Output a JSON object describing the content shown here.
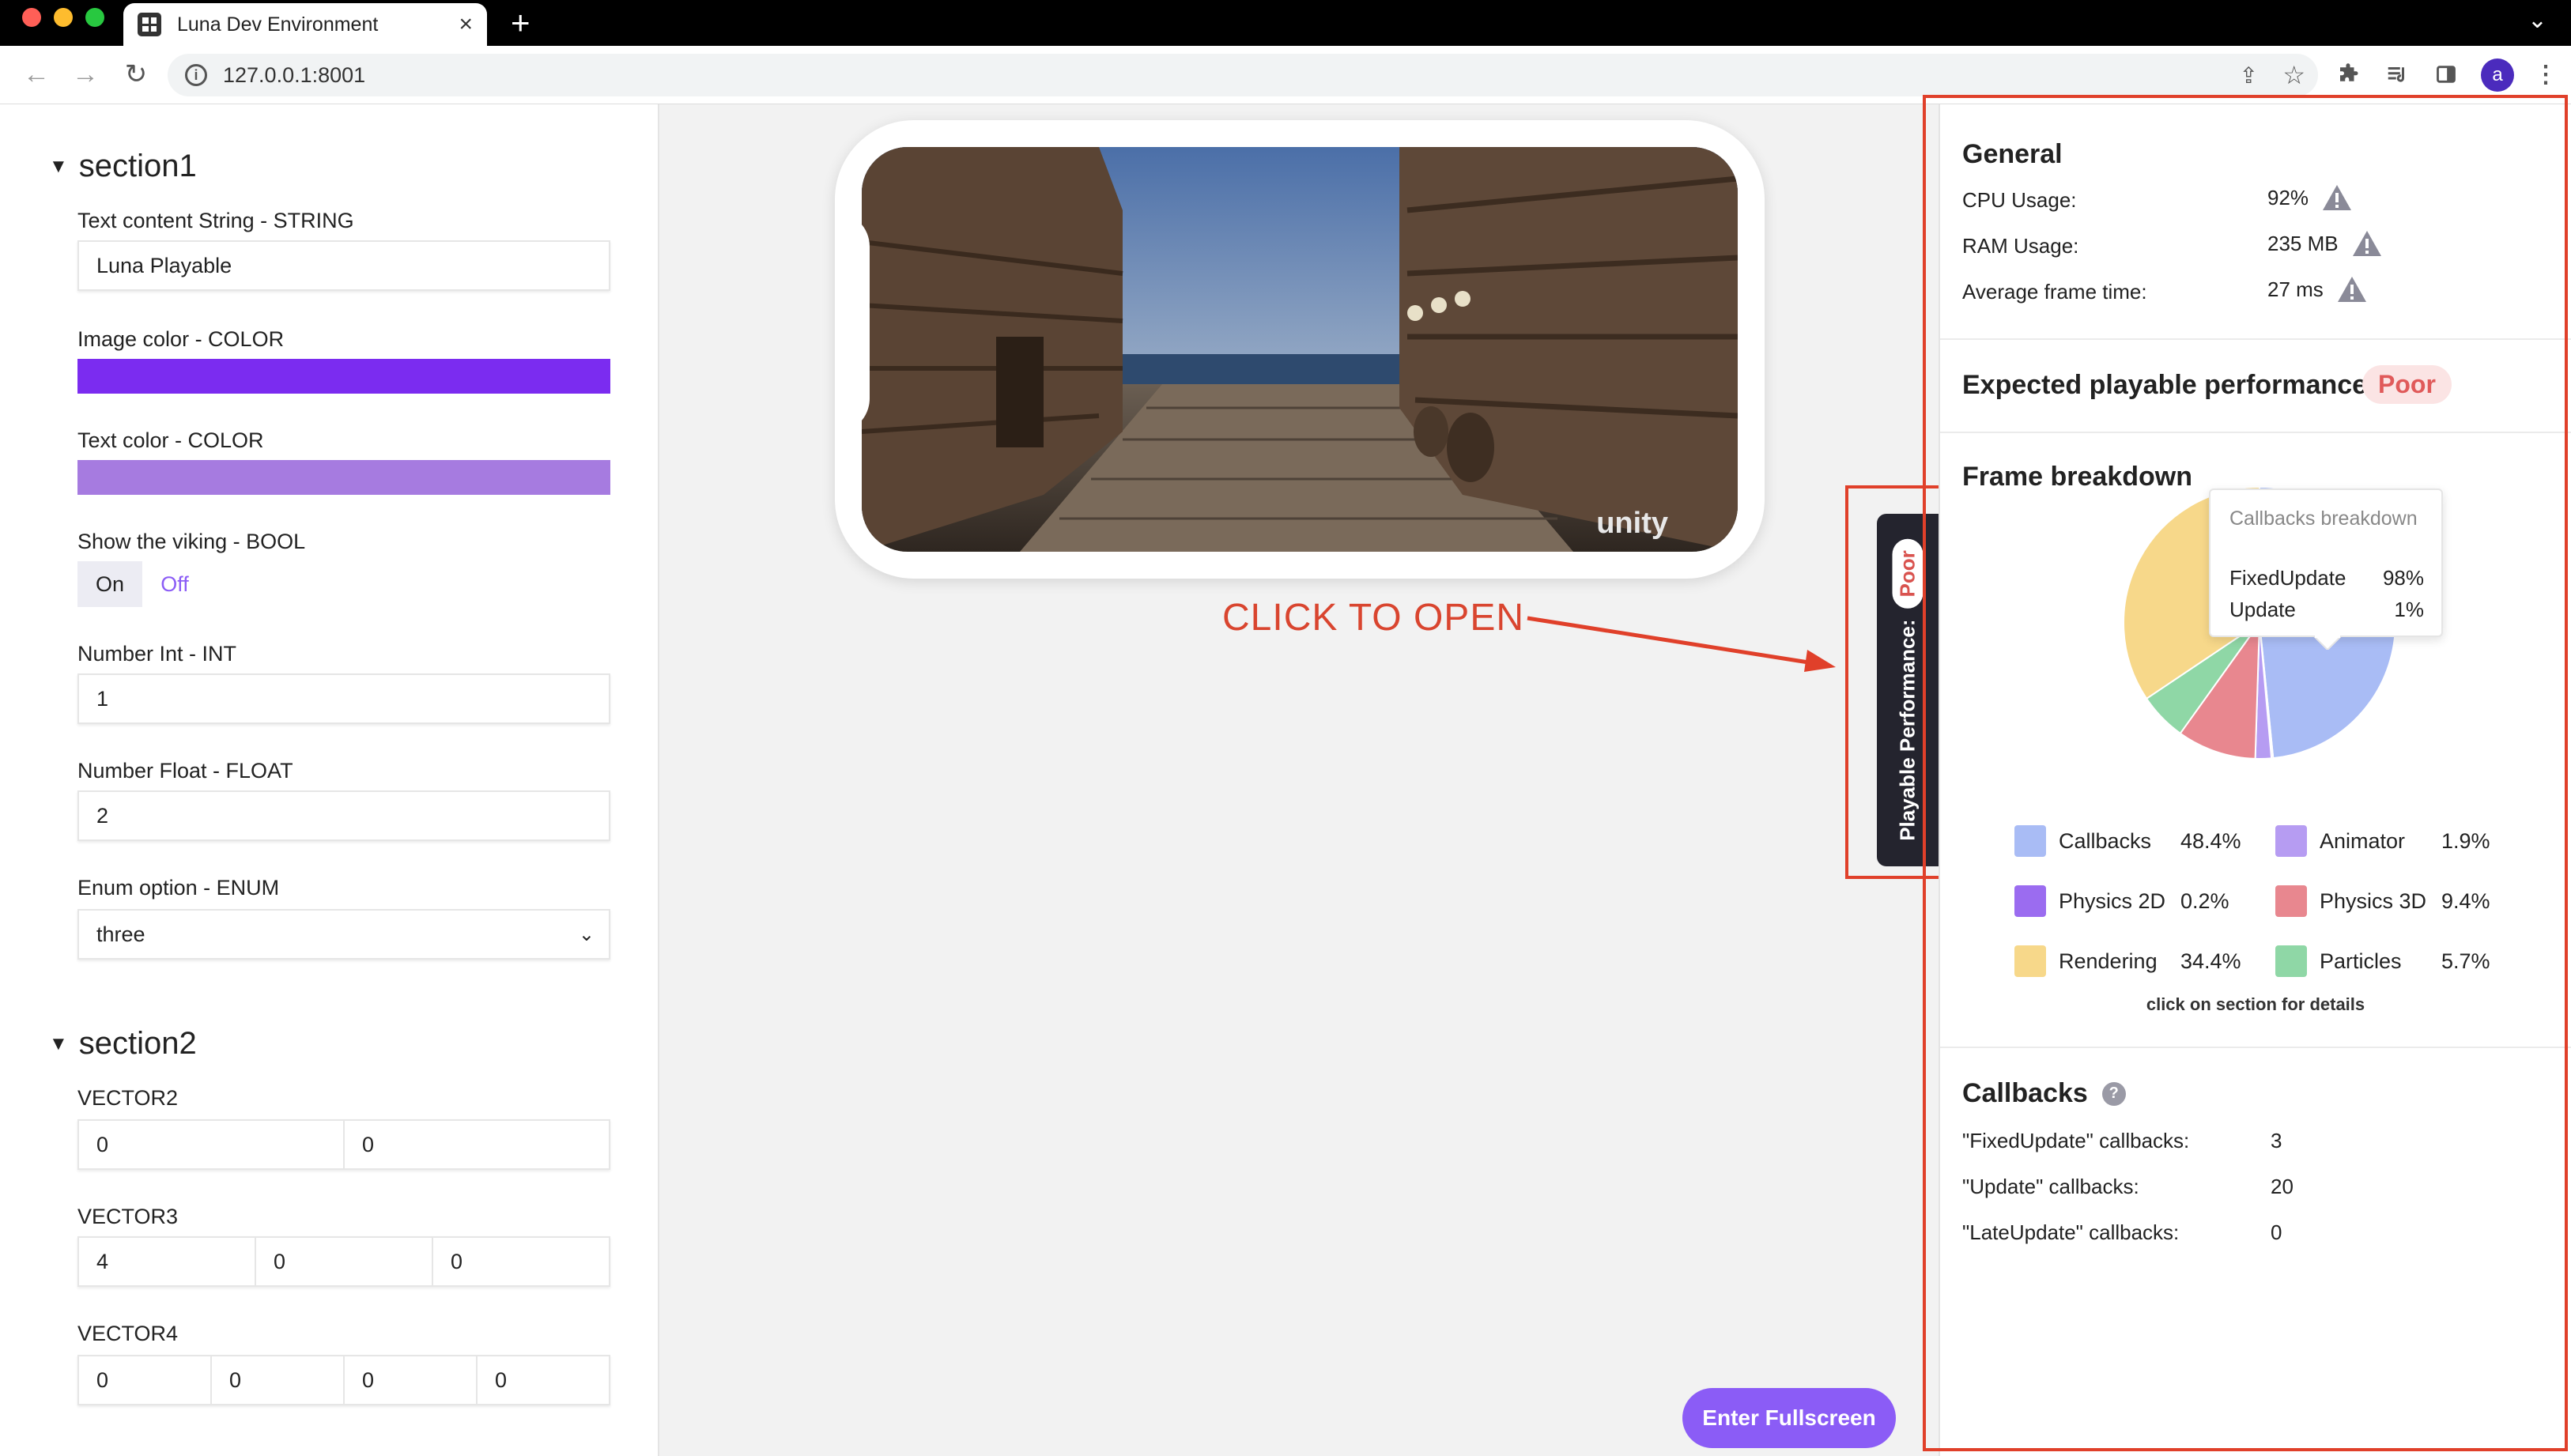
{
  "browser": {
    "tab_title": "Luna Dev Environment",
    "url": "127.0.0.1:8001",
    "avatar_letter": "a"
  },
  "left_panel": {
    "section1": {
      "name": "section1",
      "fields": {
        "text_content": {
          "label": "Text content String - STRING",
          "value": "Luna Playable"
        },
        "image_color": {
          "label": "Image color - COLOR",
          "value": "#7b2cf0"
        },
        "text_color": {
          "label": "Text color - COLOR",
          "value": "#a67be0"
        },
        "show_viking": {
          "label": "Show the viking - BOOL",
          "on": "On",
          "off": "Off",
          "selected": "Off"
        },
        "number_int": {
          "label": "Number Int - INT",
          "value": "1"
        },
        "number_float": {
          "label": "Number Float - FLOAT",
          "value": "2"
        },
        "enum_option": {
          "label": "Enum option - ENUM",
          "value": "three"
        }
      }
    },
    "section2": {
      "name": "section2",
      "vector2": {
        "label": "VECTOR2",
        "values": [
          "0",
          "0"
        ]
      },
      "vector3": {
        "label": "VECTOR3",
        "values": [
          "4",
          "0",
          "0"
        ]
      },
      "vector4": {
        "label": "VECTOR4",
        "values": [
          "0",
          "0",
          "0",
          "0"
        ]
      }
    }
  },
  "center": {
    "unity_logo": "unity",
    "annotation": "CLICK TO OPEN",
    "perf_tab": {
      "label": "Playable Performance:",
      "badge": "Poor"
    },
    "fullscreen_button": "Enter Fullscreen"
  },
  "right_panel": {
    "general": {
      "title": "General",
      "cpu": {
        "label": "CPU Usage:",
        "value": "92%"
      },
      "ram": {
        "label": "RAM Usage:",
        "value": "235 MB"
      },
      "frame_time": {
        "label": "Average frame time:",
        "value": "27 ms"
      }
    },
    "expected": {
      "title": "Expected playable performance",
      "badge": "Poor"
    },
    "frame_breakdown": {
      "title": "Frame breakdown",
      "hint": "click on section for details",
      "tooltip": {
        "title": "Callbacks breakdown",
        "rows": [
          {
            "name": "FixedUpdate",
            "value": "98%"
          },
          {
            "name": "Update",
            "value": "1%"
          }
        ]
      },
      "legend": [
        {
          "name": "Callbacks",
          "value": "48.4%",
          "color": "#a9bcf5"
        },
        {
          "name": "Animator",
          "value": "1.9%",
          "color": "#b69cf2"
        },
        {
          "name": "Physics 2D",
          "value": "0.2%",
          "color": "#9b6cf0"
        },
        {
          "name": "Physics 3D",
          "value": "9.4%",
          "color": "#e8878f"
        },
        {
          "name": "Rendering",
          "value": "34.4%",
          "color": "#f7d88a"
        },
        {
          "name": "Particles",
          "value": "5.7%",
          "color": "#8fd7a6"
        }
      ]
    },
    "callbacks": {
      "title": "Callbacks",
      "rows": [
        {
          "label": "\"FixedUpdate\" callbacks:",
          "value": "3"
        },
        {
          "label": "\"Update\" callbacks:",
          "value": "20"
        },
        {
          "label": "\"LateUpdate\" callbacks:",
          "value": "0"
        }
      ]
    }
  }
}
